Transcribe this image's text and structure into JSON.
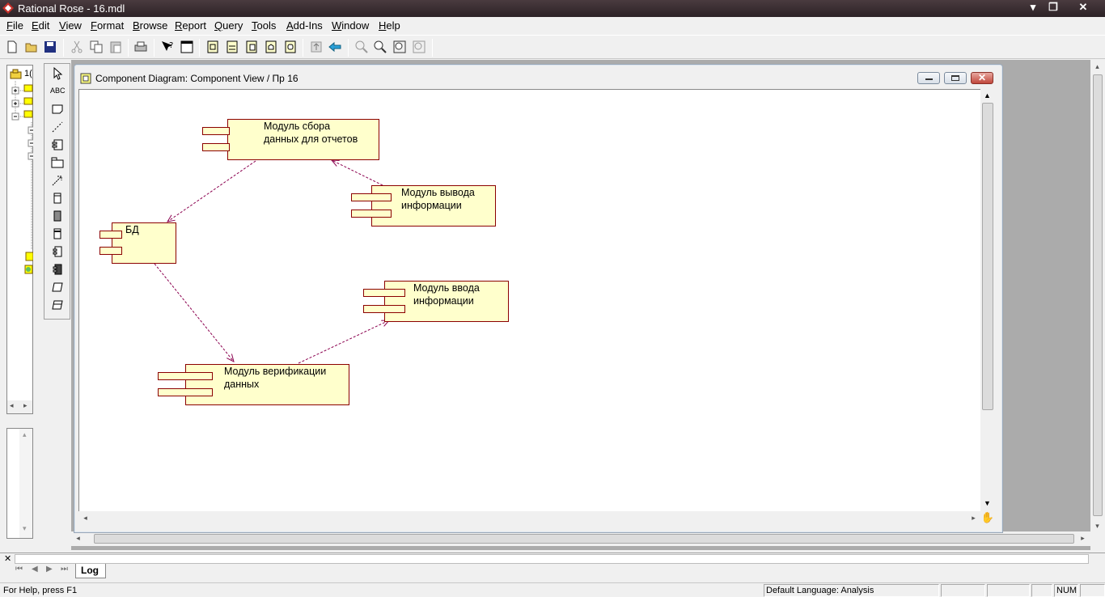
{
  "window": {
    "title": "Rational Rose - 16.mdl"
  },
  "menu": [
    "File",
    "Edit",
    "View",
    "Format",
    "Browse",
    "Report",
    "Query",
    "Tools",
    "Add-Ins",
    "Window",
    "Help"
  ],
  "browser": {
    "root_label": "1("
  },
  "diagram_window": {
    "title": "Component Diagram: Component View / Пр 16"
  },
  "components": {
    "report": "Модуль сбора\nданных для отчетов",
    "db": "БД",
    "output": "Модуль вывода\nинформации",
    "input": "Модуль ввода\nинформации",
    "verify": "Модуль верификации\nданных"
  },
  "palette_text_tool": "ABC",
  "log": {
    "tab": "Log"
  },
  "status": {
    "help": "For Help, press F1",
    "language": "Default Language: Analysis",
    "num": "NUM"
  },
  "colors": {
    "component_fill": "#ffffcc",
    "component_border": "#8b0000",
    "dependency": "#8b004f"
  }
}
